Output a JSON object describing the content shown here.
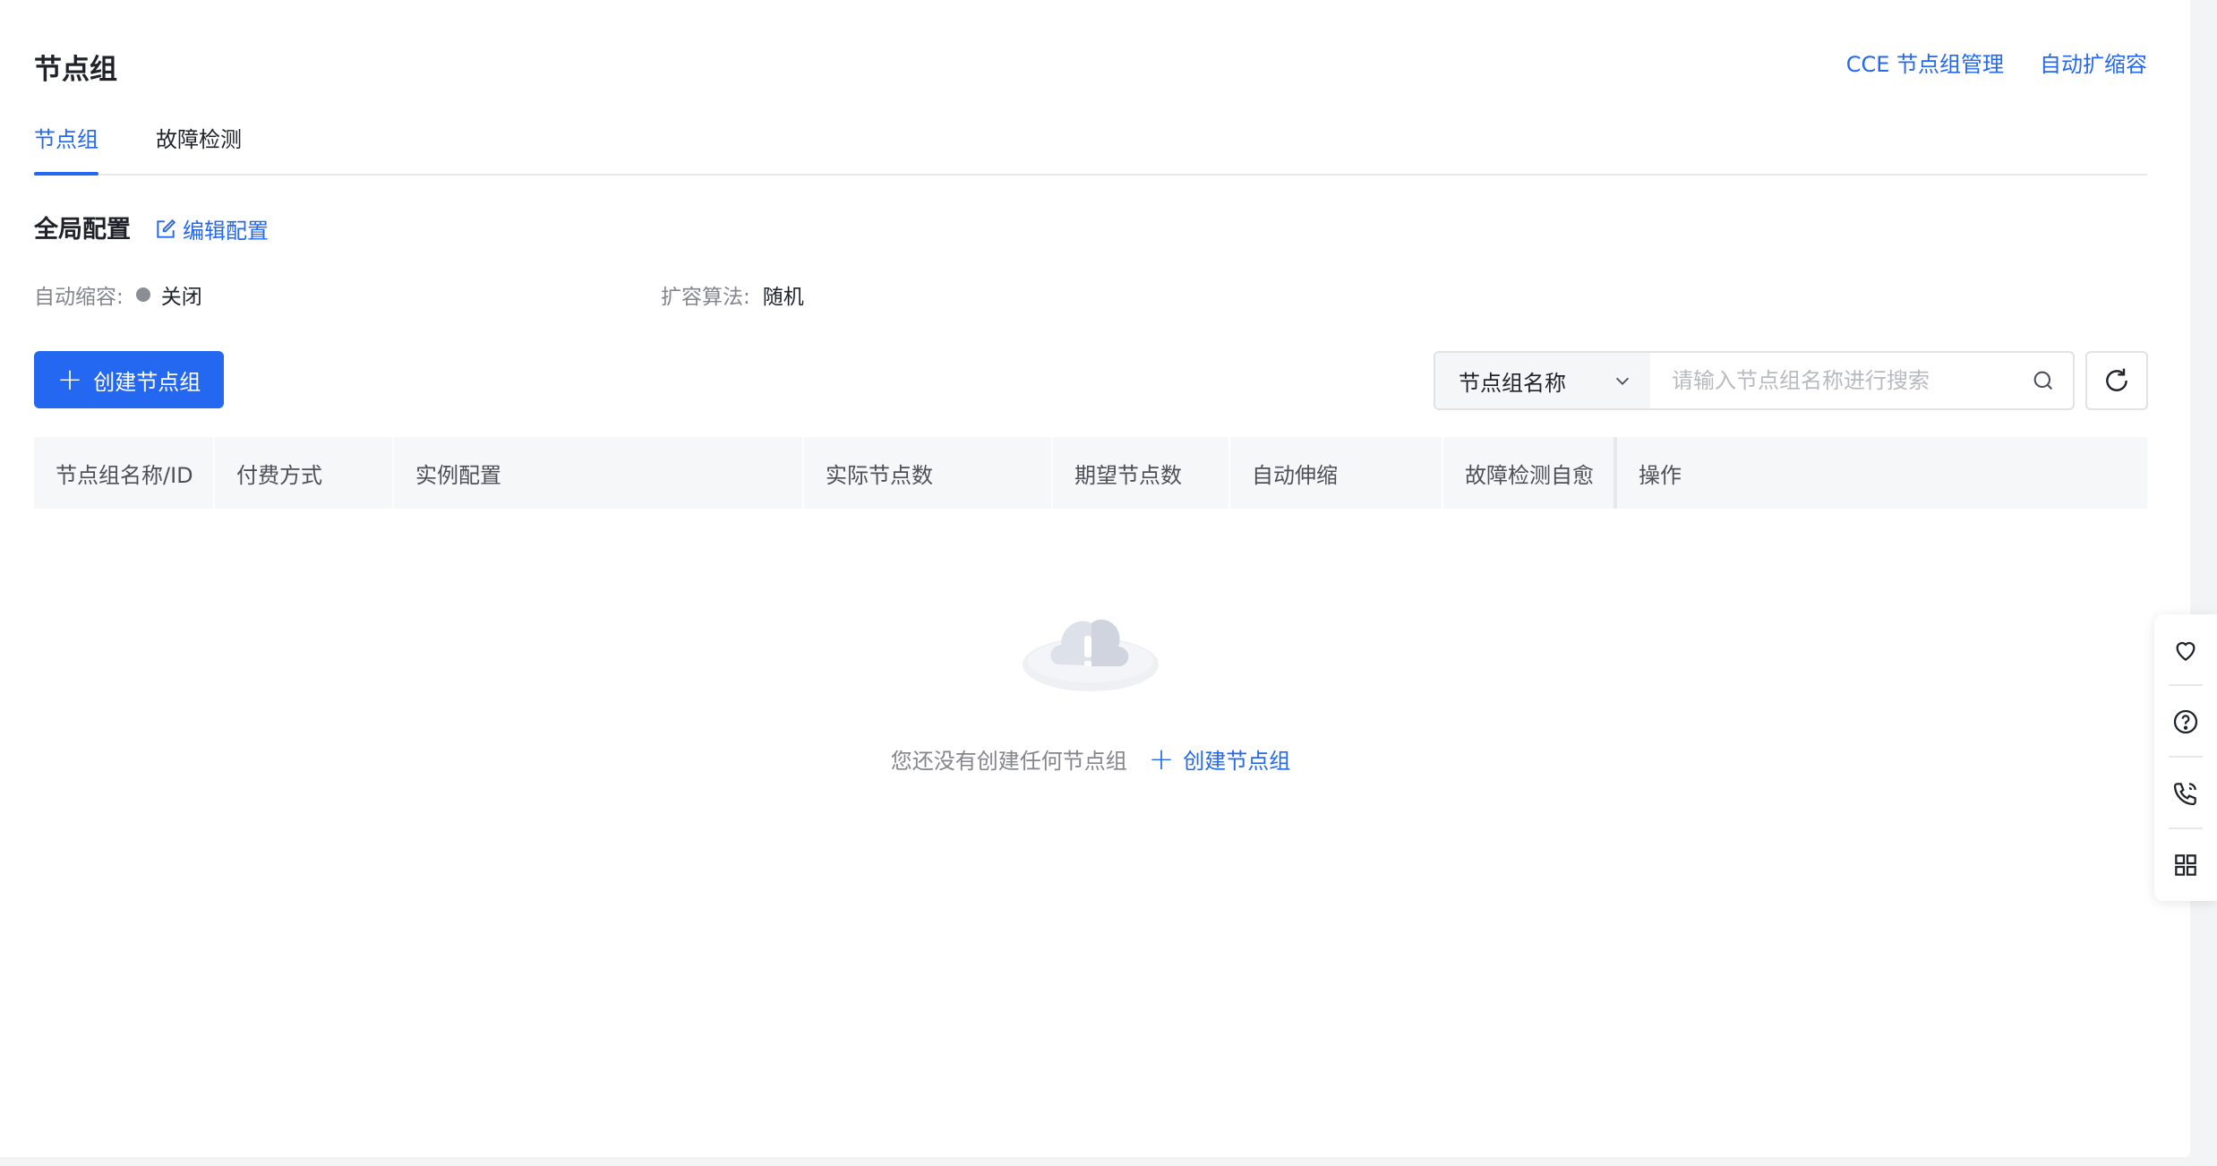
{
  "header": {
    "title": "节点组",
    "links": [
      "CCE 节点组管理",
      "自动扩缩容"
    ]
  },
  "tabs": [
    {
      "label": "节点组",
      "active": true
    },
    {
      "label": "故障检测",
      "active": false
    }
  ],
  "global_config": {
    "title": "全局配置",
    "edit_label": "编辑配置",
    "auto_scale_in_label": "自动缩容:",
    "auto_scale_in_value": "关闭",
    "scale_out_algo_label": "扩容算法:",
    "scale_out_algo_value": "随机"
  },
  "toolbar": {
    "create_label": "创建节点组",
    "search_select": "节点组名称",
    "search_placeholder": "请输入节点组名称进行搜索"
  },
  "table": {
    "columns": [
      "节点组名称/ID",
      "付费方式",
      "实例配置",
      "实际节点数",
      "期望节点数",
      "自动伸缩",
      "故障检测自愈",
      "操作"
    ]
  },
  "empty": {
    "message": "您还没有创建任何节点组",
    "create_label": "创建节点组"
  },
  "colors": {
    "accent": "#2468f2",
    "status_off": "#8a8d93"
  },
  "side_tools": [
    "heart-icon",
    "help-icon",
    "phone-icon",
    "apps-icon"
  ]
}
